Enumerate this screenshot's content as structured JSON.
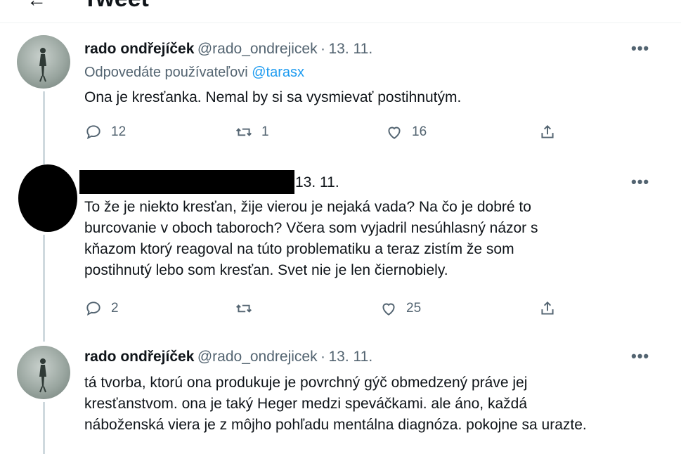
{
  "header": {
    "title": "Tweet",
    "back_icon": "arrow-left-icon"
  },
  "tweets": [
    {
      "author_name": "rado ondřejíček",
      "handle": "@rado_ondrejicek",
      "separator": "·",
      "date": "13. 11.",
      "replying_prefix": "Odpovedáte používateľovi",
      "replying_handle": "@tarasx",
      "text": "Ona je kresťanka. Nemal by si sa vysmievať postihnutým.",
      "reply_count": "12",
      "retweet_count": "1",
      "like_count": "16",
      "more_label": "•••"
    },
    {
      "date": "13. 11.",
      "text_lines": [
        "To že je niekto kresťan, žije vierou je nejaká vada? Na čo je dobré to",
        "burcovanie v oboch taboroch? Včera som vyjadril nesúhlasný názor s",
        "kňazom ktorý reagoval na túto problematiku a teraz zistím že som",
        "postihnutý lebo som kresťan. Svet nie je len čiernobiely."
      ],
      "reply_count": "2",
      "retweet_count": "",
      "like_count": "25",
      "more_label": "•••"
    },
    {
      "author_name": "rado ondřejíček",
      "handle": "@rado_ondrejicek",
      "separator": "·",
      "date": "13. 11.",
      "text_lines": [
        "tá tvorba, ktorú ona produkuje je povrchný gýč obmedzený práve jej",
        "kresťanstvom. ona je taký Heger medzi speváčkami. ale áno, každá",
        "náboženská viera je z môjho pohľadu mentálna diagnóza. pokojne sa urazte."
      ],
      "more_label": "•••"
    }
  ],
  "colors": {
    "text": "#0f1419",
    "secondary": "#536471",
    "link": "#1d9bf0",
    "line": "#cfd9de"
  }
}
